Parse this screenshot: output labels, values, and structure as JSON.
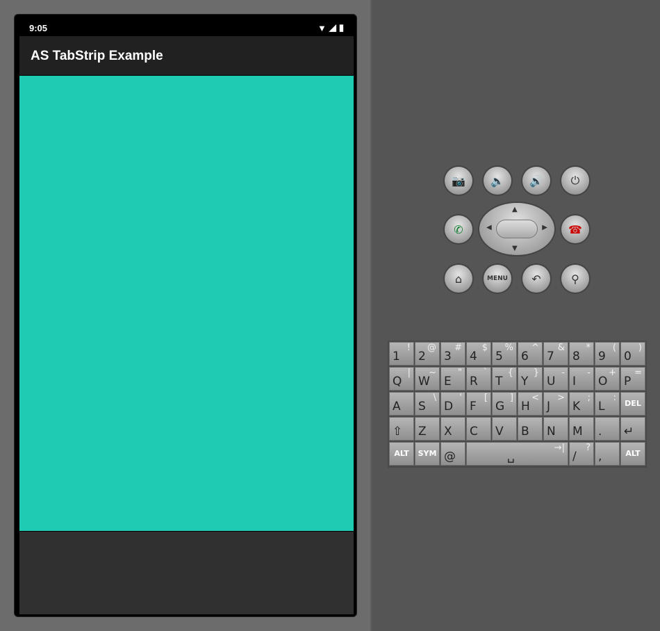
{
  "status": {
    "time": "9:05"
  },
  "app": {
    "title": "AS TabStrip Example"
  },
  "colors": {
    "content": "#20cbb3",
    "appbar": "#212121"
  },
  "controls": [
    "camera-icon",
    "volume-down-icon",
    "volume-up-icon",
    "power-icon",
    "call-icon",
    "end-call-icon",
    "home-icon",
    "menu",
    "back-icon",
    "search-icon"
  ],
  "menu_label": "MENU",
  "keyboard": {
    "rows": [
      [
        [
          "1",
          "!"
        ],
        [
          "2",
          "@"
        ],
        [
          "3",
          "#"
        ],
        [
          "4",
          "$"
        ],
        [
          "5",
          "%"
        ],
        [
          "6",
          "^"
        ],
        [
          "7",
          "&"
        ],
        [
          "8",
          "*"
        ],
        [
          "9",
          "("
        ],
        [
          "0",
          ")"
        ]
      ],
      [
        [
          "Q",
          "|"
        ],
        [
          "W",
          "~"
        ],
        [
          "E",
          "\""
        ],
        [
          "R",
          "`"
        ],
        [
          "T",
          "{"
        ],
        [
          "Y",
          "}"
        ],
        [
          "U",
          "-"
        ],
        [
          "I",
          "-"
        ],
        [
          "O",
          "+"
        ],
        [
          "P",
          "="
        ]
      ],
      [
        [
          "A",
          ""
        ],
        [
          "S",
          "\\"
        ],
        [
          "D",
          "'"
        ],
        [
          "F",
          "["
        ],
        [
          "G",
          "]"
        ],
        [
          "H",
          "<"
        ],
        [
          "J",
          ">"
        ],
        [
          "K",
          ";"
        ],
        [
          "L",
          ":"
        ],
        [
          "DEL",
          ""
        ]
      ],
      [
        [
          "⇧",
          ""
        ],
        [
          "Z",
          ""
        ],
        [
          "X",
          ""
        ],
        [
          "C",
          ""
        ],
        [
          "V",
          ""
        ],
        [
          "B",
          ""
        ],
        [
          "N",
          ""
        ],
        [
          "M",
          ""
        ],
        [
          ".",
          ""
        ],
        [
          "↵",
          ""
        ]
      ],
      [
        [
          "ALT",
          ""
        ],
        [
          "SYM",
          ""
        ],
        [
          "@",
          ""
        ],
        [
          "␣",
          "→|"
        ],
        [
          "/",
          "?"
        ],
        [
          ",",
          ""
        ],
        [
          "ALT",
          ""
        ]
      ]
    ]
  }
}
